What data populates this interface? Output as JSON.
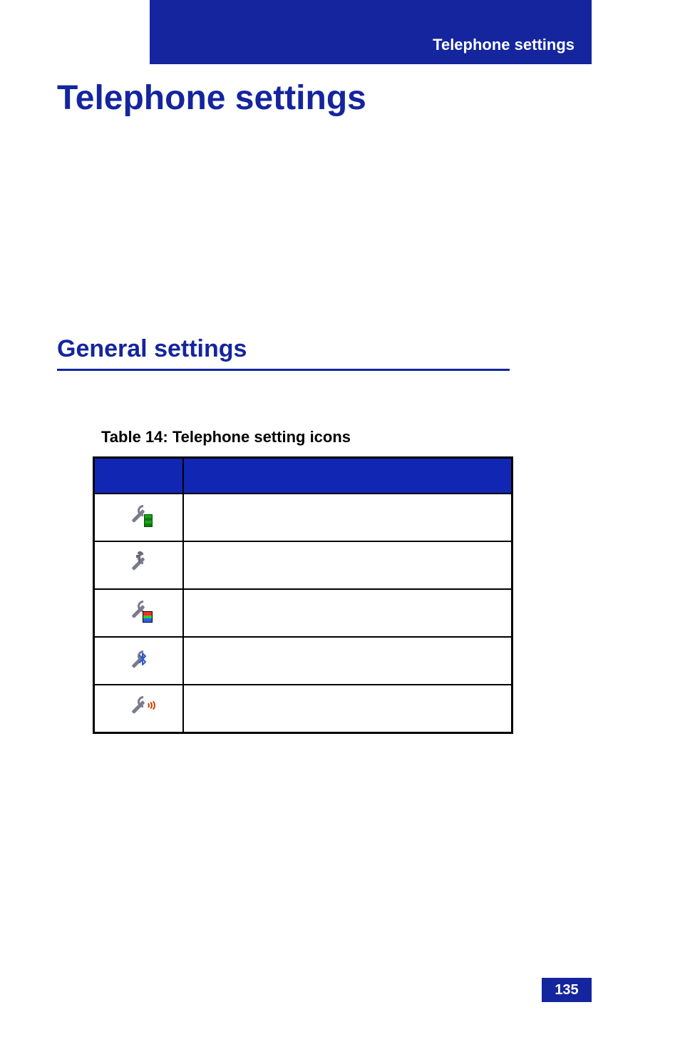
{
  "header": {
    "running_title": "Telephone settings"
  },
  "page": {
    "title": "Telephone settings",
    "number": "135"
  },
  "section": {
    "title": "General settings"
  },
  "table": {
    "caption": "Table 14: Telephone setting icons",
    "headers": {
      "icon": "",
      "description": ""
    },
    "rows": [
      {
        "icon_name": "wrench-phone-icon",
        "description": ""
      },
      {
        "icon_name": "wrench-note-icon",
        "description": ""
      },
      {
        "icon_name": "wrench-palette-icon",
        "description": ""
      },
      {
        "icon_name": "wrench-bluetooth-icon",
        "description": ""
      },
      {
        "icon_name": "wrench-connectivity-icon",
        "description": ""
      }
    ]
  }
}
